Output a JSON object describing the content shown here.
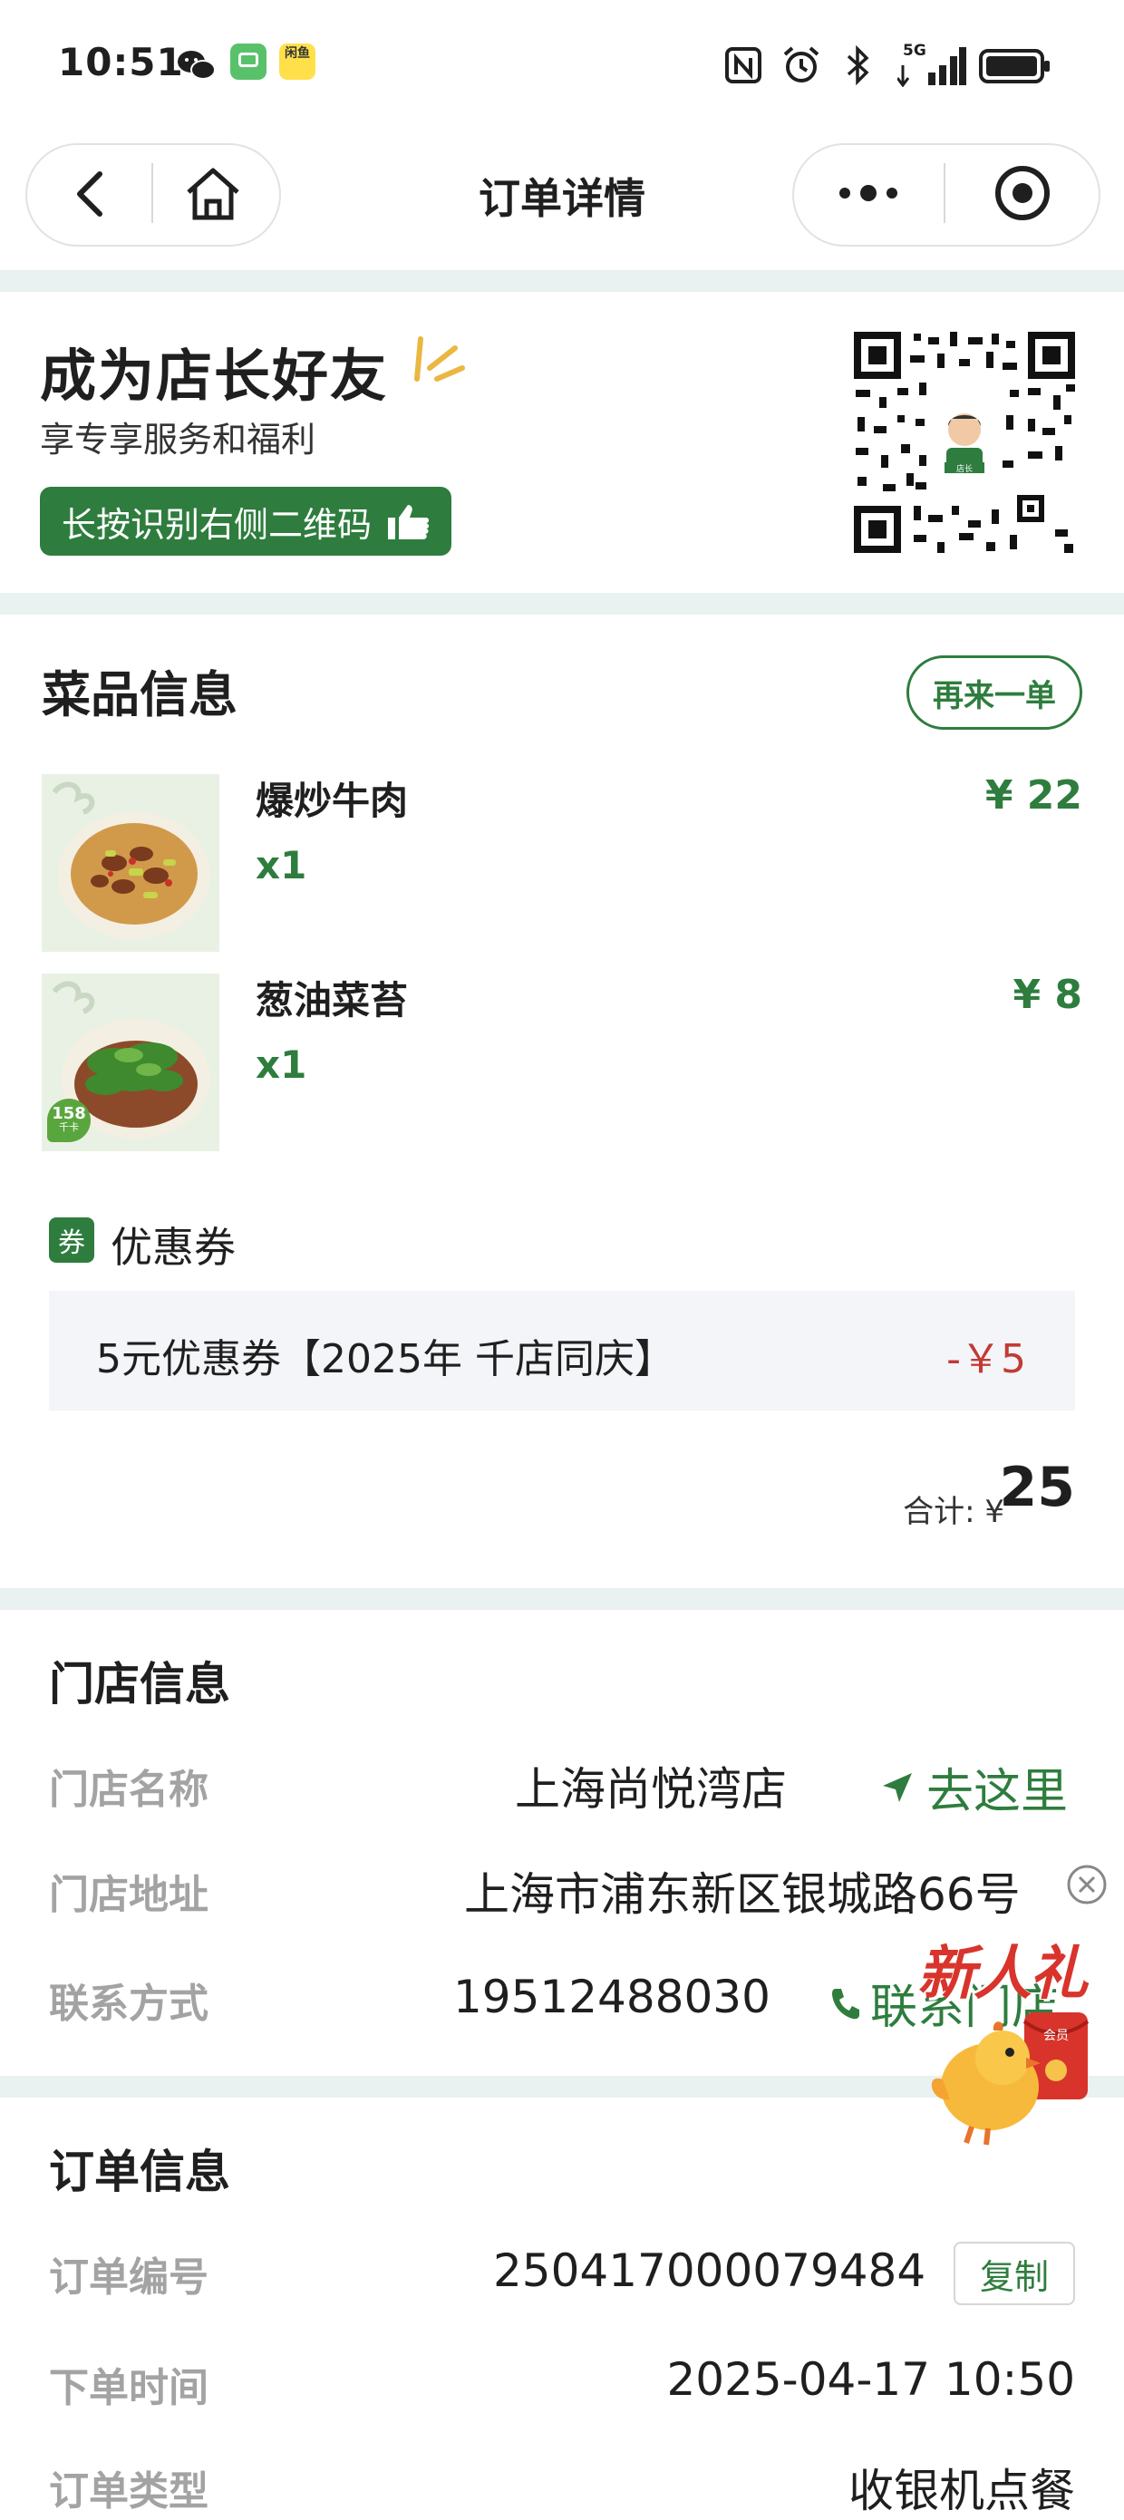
{
  "status_bar": {
    "time": "10:51",
    "app_icons": [
      "wechat-icon",
      "message-icon",
      "app-icon"
    ],
    "app_badge_text": "闲鱼",
    "system_icons": [
      "nfc-icon",
      "alarm-icon",
      "bluetooth-icon",
      "signal-5g-icon",
      "battery-icon"
    ],
    "network": "5G"
  },
  "nav": {
    "title": "订单详情",
    "left_buttons": [
      "back-icon",
      "home-icon"
    ],
    "right_buttons": [
      "more-icon",
      "record-icon"
    ]
  },
  "promo": {
    "title": "成为店长好友",
    "subtitle": "享专享服务和福利",
    "button_label": "长按识别右侧二维码",
    "qr_center_label": "店长"
  },
  "dishes": {
    "title": "菜品信息",
    "reorder_label": "再来一单",
    "items": [
      {
        "name": "爆炒牛肉",
        "qty": "x1",
        "price": "¥ 22"
      },
      {
        "name": "葱油菜苔",
        "qty": "x1",
        "price": "¥ 8",
        "badge": "158",
        "badge_sub": "千卡"
      }
    ],
    "coupon": {
      "tag": "券",
      "heading": "优惠券",
      "name": "5元优惠券【2025年 千店同庆】",
      "amount": "-￥5"
    },
    "total_label": "合计: ¥",
    "total_value": "25"
  },
  "store": {
    "title": "门店信息",
    "name_label": "门店名称",
    "name_value": "上海尚悦湾店",
    "go_label": "去这里",
    "address_label": "门店地址",
    "address_value": "上海市浦东新区银城路66号",
    "contact_label": "联系方式",
    "contact_value": "19512488030",
    "contact_link": "联系门店"
  },
  "floating_promo": {
    "text": "新人礼",
    "packet_text": "会员"
  },
  "order": {
    "title": "订单信息",
    "number_label": "订单编号",
    "number_value": "250417000079484",
    "copy_label": "复制",
    "time_label": "下单时间",
    "time_value": "2025-04-17 10:50",
    "type_label": "订单类型",
    "type_value": "收银机点餐"
  },
  "colors": {
    "brand_green": "#2e7d3e",
    "discount_red": "#c23a36",
    "separator": "#eaf1f1",
    "muted_label": "#a3a3a3"
  }
}
